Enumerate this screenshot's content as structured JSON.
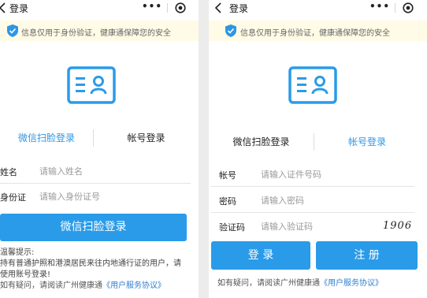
{
  "nav": {
    "title": "登录",
    "more_symbol": "•••"
  },
  "notice": {
    "text": "信息仅用于身份验证，健康通保障您的安全"
  },
  "left": {
    "tabs": [
      "微信扫脸登录",
      "帐号登录"
    ],
    "active_tab": 0,
    "fields": [
      {
        "label": "姓名",
        "placeholder": "请输入姓名",
        "value": ""
      },
      {
        "label": "身份证",
        "placeholder": "请输入身份证号",
        "value": ""
      }
    ],
    "primary_button": "微信扫脸登录",
    "tips_title": "温馨提示:",
    "tips_line1": "持有普通护照和港澳居民来往内地通行证的用户，请",
    "tips_line2": "使用账号登录!",
    "footer_prefix": "如有疑问，请阅读广州健康通",
    "footer_link": "《用户服务协议》"
  },
  "right": {
    "tabs": [
      "微信扫脸登录",
      "帐号登录"
    ],
    "active_tab": 1,
    "fields": [
      {
        "label": "帐号",
        "placeholder": "请输入证件号码",
        "value": ""
      },
      {
        "label": "密码",
        "placeholder": "请输入密码",
        "value": ""
      },
      {
        "label": "验证码",
        "placeholder": "请输入验证码",
        "value": ""
      }
    ],
    "captcha_text": "1906",
    "login_button": "登 录",
    "register_button": "注 册",
    "footer_prefix": "如有疑问，请阅读广州健康通",
    "footer_link": "《用户服务协议》"
  },
  "colors": {
    "accent": "#2a9be9",
    "tab_active": "#2f96e6",
    "notice_bg": "#fffbe6",
    "link": "#2f7fd0"
  },
  "icons": {
    "back": "chevron-left-icon",
    "more": "more-dots-icon",
    "capsule_close": "target-circle-icon",
    "notice": "shield-check-icon",
    "hero": "id-card-icon"
  }
}
